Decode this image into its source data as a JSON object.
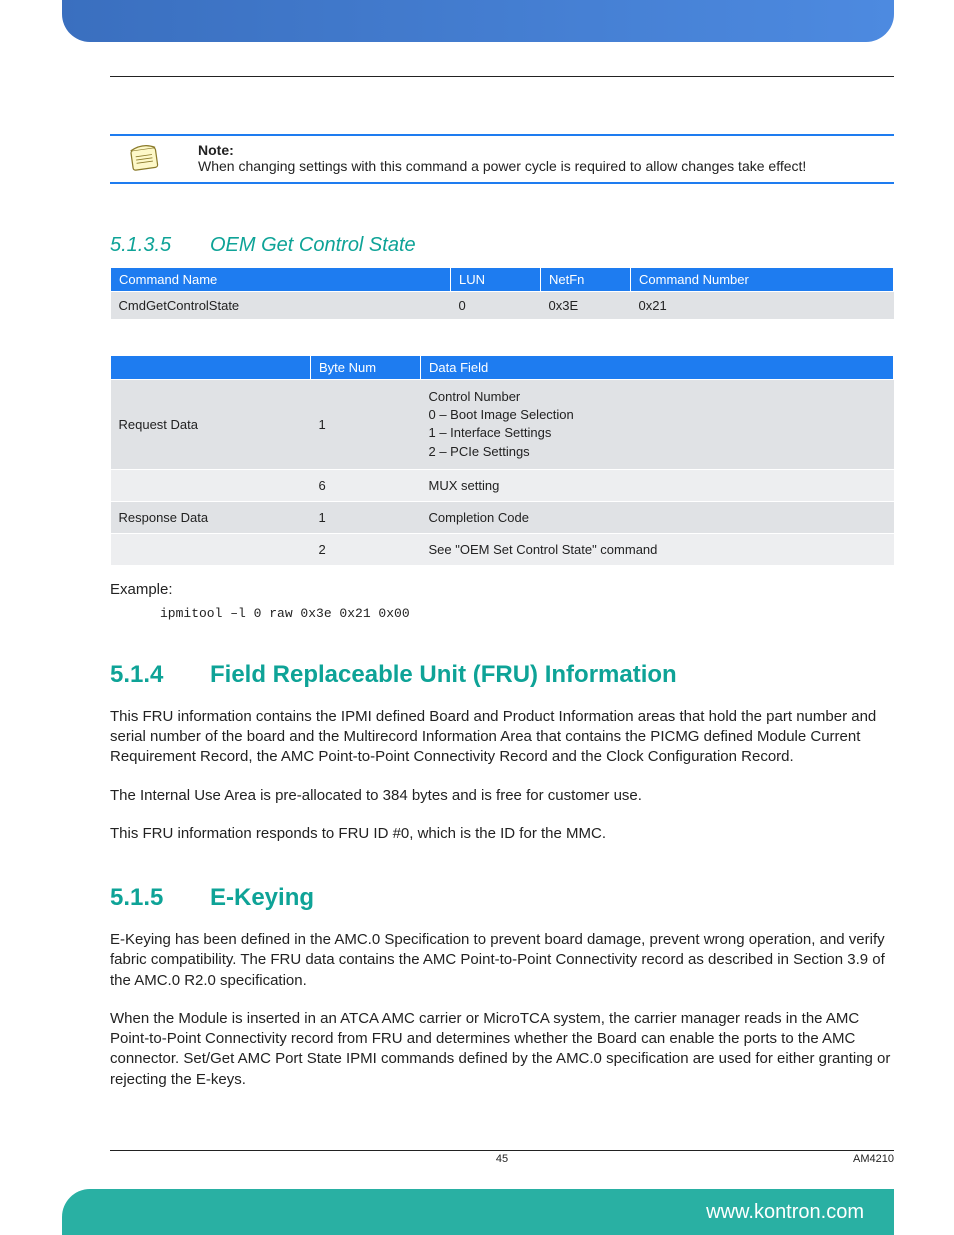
{
  "note": {
    "heading": "Note:",
    "text": "When changing settings with this command a power cycle is required to allow changes take effect!"
  },
  "section_5135": {
    "number": "5.1.3.5",
    "title": "OEM Get Control State"
  },
  "cmd_table": {
    "headers": {
      "name": "Command Name",
      "lun": "LUN",
      "netfn": "NetFn",
      "cmdnum": "Command Number"
    },
    "row": {
      "name": "CmdGetControlState",
      "lun": "0",
      "netfn": "0x3E",
      "cmdnum": "0x21"
    }
  },
  "reg_table": {
    "headers": {
      "blank": "",
      "byte": "Byte Num",
      "data": "Data Field"
    },
    "rows": [
      {
        "label": "Request Data",
        "byte": "1",
        "data": "Control Number\n0 – Boot Image Selection\n1 – Interface Settings\n2 – PCIe Settings",
        "shade": "shade"
      },
      {
        "label": "",
        "byte": "6",
        "data": "MUX setting",
        "shade": "light"
      },
      {
        "label": "Response Data",
        "byte": "1",
        "data": "Completion Code",
        "shade": "shade"
      },
      {
        "label": "",
        "byte": "2",
        "data": "See \"OEM Set  Control State\" command",
        "shade": "light"
      }
    ]
  },
  "example": {
    "label": "Example:",
    "code": "ipmitool –l 0 raw 0x3e 0x21 0x00"
  },
  "section_514": {
    "number": "5.1.4",
    "title": "Field Replaceable Unit (FRU) Information",
    "p1": "This FRU information contains the IPMI defined Board and Product Information areas that hold the part number and serial number of the board and the Multirecord Information Area that contains the PICMG defined Module Current Requirement Record, the AMC Point-to-Point Connectivity Record and the Clock Configuration Record.",
    "p2": "The Internal Use Area is pre-allocated to 384 bytes and is free for customer use.",
    "p3": "This FRU information responds to FRU ID #0, which is the ID for the MMC."
  },
  "section_515": {
    "number": "5.1.5",
    "title": "E-Keying",
    "p1": "E-Keying has been defined in the AMC.0 Specification to prevent board damage, prevent wrong operation, and verify fabric compatibility. The FRU data contains the AMC Point-to-Point Connectivity record as described in Section 3.9 of the AMC.0 R2.0 specification.",
    "p2": "When the Module is inserted in an ATCA AMC carrier or MicroTCA system, the carrier manager reads in the AMC Point-to-Point Connectivity record from FRU and determines whether the Board can enable the ports to the AMC connector. Set/Get AMC Port State IPMI commands defined by the AMC.0 specification are used for either granting or rejecting the E-keys."
  },
  "footer": {
    "page": "45",
    "product": "AM4210",
    "url": "www.kontron.com"
  }
}
